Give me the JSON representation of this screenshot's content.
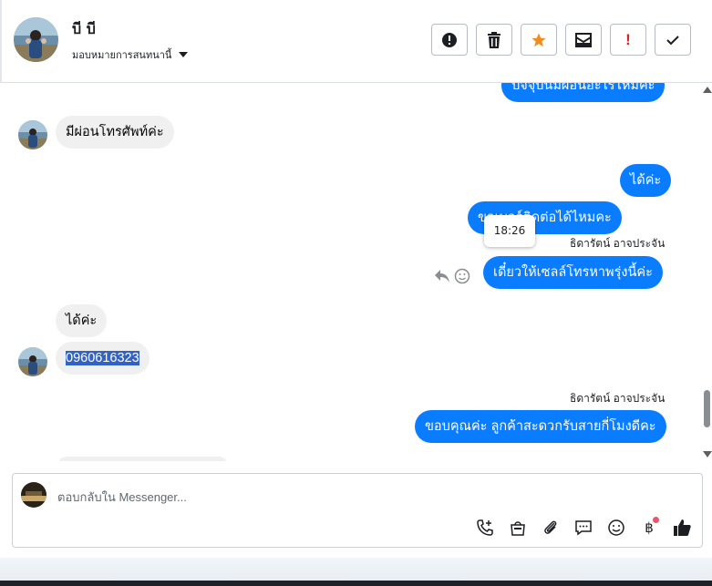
{
  "header": {
    "contact_name": "บี บี",
    "assign_label": "มอบหมายการสนทนานี้",
    "toolbar": [
      {
        "name": "spam-button",
        "icon": "alert-circle-icon",
        "color": "#1c1e21"
      },
      {
        "name": "delete-button",
        "icon": "trash-icon",
        "color": "#1c1e21"
      },
      {
        "name": "star-button",
        "icon": "star-icon",
        "color": "#f28c1e"
      },
      {
        "name": "unread-button",
        "icon": "envelope-icon",
        "color": "#1c1e21"
      },
      {
        "name": "follow-up-button",
        "icon": "exclamation-icon",
        "color": "#e02020",
        "glyph": "!"
      },
      {
        "name": "done-button",
        "icon": "check-icon",
        "color": "#1c1e21"
      }
    ]
  },
  "thread": {
    "messages": [
      {
        "id": "m1",
        "side": "out",
        "text": "ปัจจุบันมีผ่อนอะไรไหมคะ",
        "partial": true
      },
      {
        "id": "m2",
        "side": "in",
        "text": "มีผ่อนโทรศัพท์ค่ะ"
      },
      {
        "id": "m3",
        "side": "out",
        "text": "ได้ค่ะ"
      },
      {
        "id": "m4",
        "side": "out",
        "text": "ขอเบอร์ติดต่อได้ไหมคะ",
        "partial_prefix": "เบอร์ติดต่อได้ไหมคะ"
      },
      {
        "id": "m5",
        "side": "out",
        "text": "เดี๋ยวให้เซลล์โทรหาพรุ่งนี้ค่ะ",
        "sender": "ธิดารัตน์ อาจประจัน"
      },
      {
        "id": "m6",
        "side": "in",
        "text": "ได้ค่ะ"
      },
      {
        "id": "m7",
        "side": "in",
        "text": "0960616323",
        "highlighted": true
      },
      {
        "id": "m8",
        "side": "out",
        "text": "ขอบคุณค่ะ ลูกค้าสะดวกรับสายกี่โมงดีคะ",
        "sender": "ธิดารัตน์ อาจประจัน"
      }
    ],
    "tooltip_time": "18:26"
  },
  "composer": {
    "placeholder": "ตอบกลับใน Messenger...",
    "icons": [
      "add-call-icon",
      "shopping-bag-icon",
      "attachment-icon",
      "saved-reply-icon",
      "emoji-icon",
      "baht-payment-icon",
      "like-icon"
    ]
  },
  "colors": {
    "accent": "#0a7cff",
    "incoming": "#f0f0f0",
    "notification_dot": "#e9566b",
    "highlight": "#3162c4"
  }
}
